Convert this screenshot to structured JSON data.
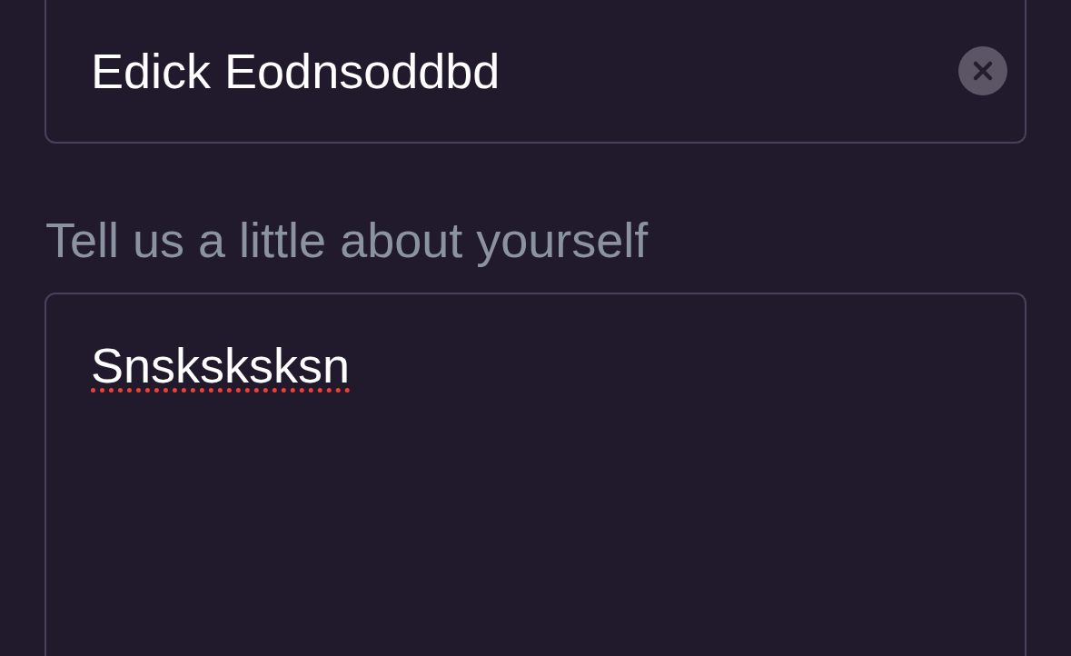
{
  "name_field": {
    "value": "Edick Eodnsoddbd",
    "clear_button": true
  },
  "about_field": {
    "label": "Tell us a little about yourself",
    "value": "Snsksksksn",
    "misspelled": true
  }
}
